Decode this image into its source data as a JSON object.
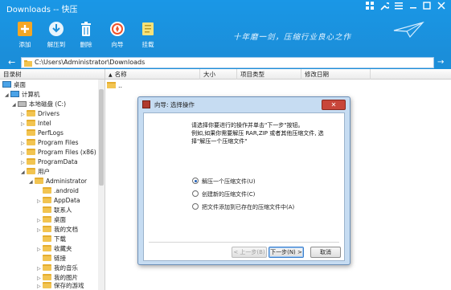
{
  "app": {
    "title": "Downloads -- 快压"
  },
  "window_controls": [
    "grid-icon",
    "wrench-icon",
    "menu-icon",
    "minimize-icon",
    "maximize-icon",
    "close-icon"
  ],
  "toolbar": {
    "add": "添加",
    "extract": "解压到",
    "delete": "删除",
    "wizard": "向导",
    "mount": "挂载"
  },
  "slogan": "十年磨一剑，压缩行业良心之作",
  "address": {
    "path": "C:\\Users\\Administrator\\Downloads"
  },
  "tree": {
    "header": "目录树",
    "items": [
      {
        "label": "桌面",
        "type": "desktop"
      },
      {
        "label": "计算机",
        "type": "pc"
      },
      {
        "label": "本地磁盘 (C:)",
        "type": "disk"
      },
      {
        "label": "Drivers",
        "type": "folder"
      },
      {
        "label": "Intel",
        "type": "folder"
      },
      {
        "label": "PerfLogs",
        "type": "folder"
      },
      {
        "label": "Program Files",
        "type": "folder"
      },
      {
        "label": "Program Files (x86)",
        "type": "folder"
      },
      {
        "label": "ProgramData",
        "type": "folder"
      },
      {
        "label": "用户",
        "type": "folder"
      },
      {
        "label": "Administrator",
        "type": "folder"
      },
      {
        "label": ".android",
        "type": "folder"
      },
      {
        "label": "AppData",
        "type": "folder"
      },
      {
        "label": "联系人",
        "type": "folder"
      },
      {
        "label": "桌面",
        "type": "folder"
      },
      {
        "label": "我的文档",
        "type": "folder"
      },
      {
        "label": "下载",
        "type": "folder"
      },
      {
        "label": "收藏夹",
        "type": "folder"
      },
      {
        "label": "链接",
        "type": "folder"
      },
      {
        "label": "我的音乐",
        "type": "folder"
      },
      {
        "label": "我的图片",
        "type": "folder"
      },
      {
        "label": "保存的游戏",
        "type": "folder"
      }
    ]
  },
  "list": {
    "columns": [
      "名称",
      "大小",
      "项目类型",
      "修改日期"
    ],
    "parent_row": ".."
  },
  "dialog": {
    "title": "向导: 选择操作",
    "close": "✕",
    "instruction": "请选择你要进行的操作并单击\"下一步\"按钮。\n例如,如果你需要解压 RAR,ZIP 或者其他压缩文件, 选择\"解压一个压缩文件\"",
    "options": [
      "解压一个压缩文件(U)",
      "创建新的压缩文件(C)",
      "把文件添加到已存在的压缩文件中(A)"
    ],
    "selected_option": 0,
    "buttons": {
      "back": "< 上一步(B)",
      "next": "下一步(N) >",
      "cancel": "取消"
    }
  }
}
